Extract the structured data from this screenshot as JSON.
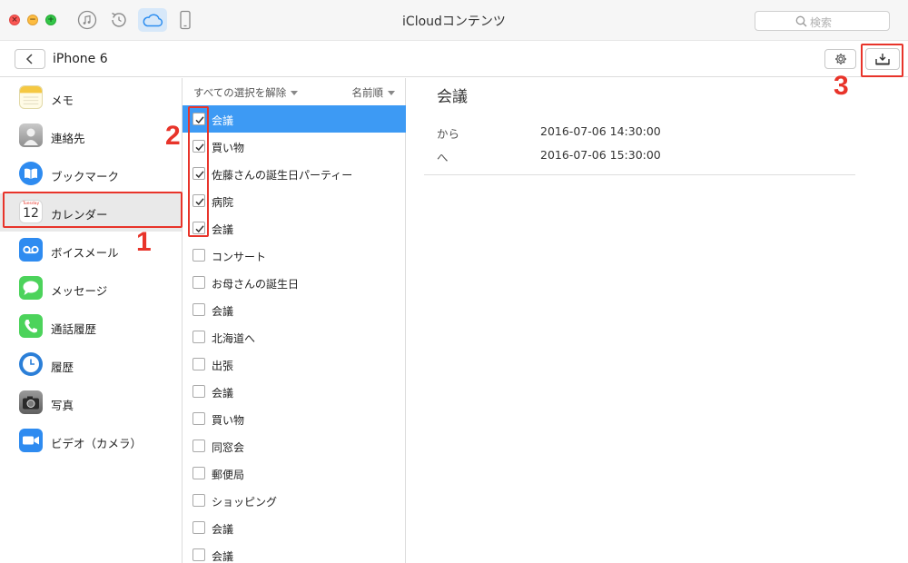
{
  "window": {
    "title": "iCloudコンテンツ",
    "search_placeholder": "検索"
  },
  "toolbar": {
    "device_name": "iPhone 6"
  },
  "sidebar": {
    "items": [
      {
        "label": "メモ",
        "icon": "notes-icon"
      },
      {
        "label": "連絡先",
        "icon": "contacts-icon"
      },
      {
        "label": "ブックマーク",
        "icon": "bookmarks-icon"
      },
      {
        "label": "カレンダー",
        "icon": "calendar-icon",
        "selected": true,
        "calendar_day_name": "Tuesday",
        "calendar_day": "12"
      },
      {
        "label": "ボイスメール",
        "icon": "voicemail-icon"
      },
      {
        "label": "メッセージ",
        "icon": "messages-icon"
      },
      {
        "label": "通話履歴",
        "icon": "phone-icon"
      },
      {
        "label": "履歴",
        "icon": "history-clock-icon"
      },
      {
        "label": "写真",
        "icon": "camera-icon"
      },
      {
        "label": "ビデオ（カメラ）",
        "icon": "video-camera-icon"
      }
    ]
  },
  "list": {
    "deselect_all": "すべての選択を解除",
    "sort_label": "名前順",
    "items": [
      {
        "title": "会議",
        "checked": true,
        "selected": true
      },
      {
        "title": "買い物",
        "checked": true
      },
      {
        "title": "佐藤さんの誕生日パーティー",
        "checked": true
      },
      {
        "title": "病院",
        "checked": true
      },
      {
        "title": "会議",
        "checked": true
      },
      {
        "title": "コンサート",
        "checked": false
      },
      {
        "title": "お母さんの誕生日",
        "checked": false
      },
      {
        "title": "会議",
        "checked": false
      },
      {
        "title": "北海道へ",
        "checked": false
      },
      {
        "title": "出張",
        "checked": false
      },
      {
        "title": "会議",
        "checked": false
      },
      {
        "title": "買い物",
        "checked": false
      },
      {
        "title": "同窓会",
        "checked": false
      },
      {
        "title": "郵便局",
        "checked": false
      },
      {
        "title": "ショッピング",
        "checked": false
      },
      {
        "title": "会議",
        "checked": false
      },
      {
        "title": "会議",
        "checked": false
      }
    ]
  },
  "detail": {
    "title": "会議",
    "from_label": "から",
    "from_value": "2016-07-06 14:30:00",
    "to_label": "へ",
    "to_value": "2016-07-06 15:30:00"
  },
  "annotations": {
    "step1": "1",
    "step2": "2",
    "step3": "3"
  },
  "colors": {
    "selection_blue": "#3d9af4",
    "annotation_red": "#e8342a",
    "toolbar_active": "#d7e8f9"
  }
}
